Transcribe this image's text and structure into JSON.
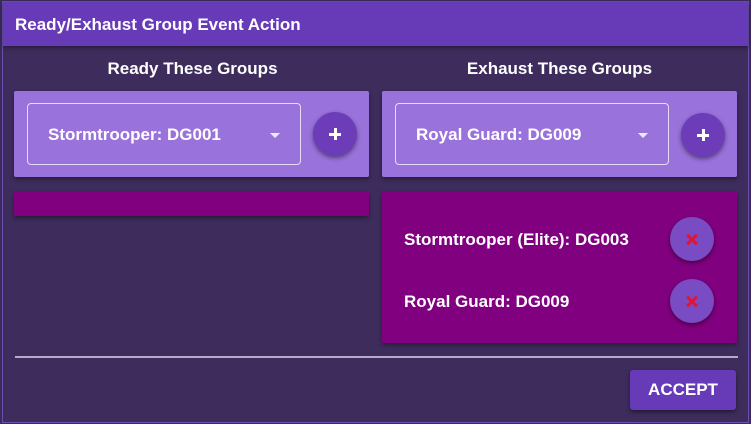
{
  "dialog": {
    "title": "Ready/Exhaust Group Event Action",
    "accept_label": "ACCEPT"
  },
  "ready": {
    "heading": "Ready These Groups",
    "selected": "Stormtrooper: DG001",
    "items": []
  },
  "exhaust": {
    "heading": "Exhaust These Groups",
    "selected": "Royal Guard: DG009",
    "items": [
      {
        "label": "Stormtrooper (Elite): DG003"
      },
      {
        "label": "Royal Guard: DG009"
      }
    ]
  },
  "icons": {
    "add": "plus-icon",
    "remove": "close-icon",
    "dropdown": "chevron-down-icon"
  },
  "colors": {
    "titlebar": "#673ab7",
    "panel": "#9a72dc",
    "list": "#800080",
    "background": "#3d2c5c",
    "remove_icon": "#e01535"
  }
}
